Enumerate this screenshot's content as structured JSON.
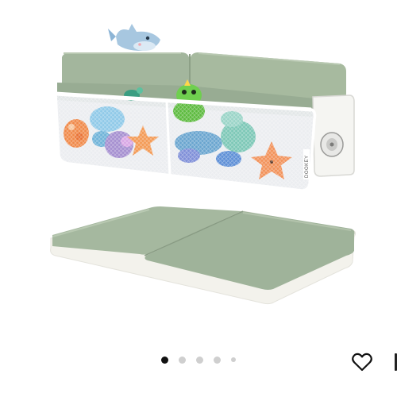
{
  "product": {
    "brand_label": "DOOKEY"
  },
  "carousel": {
    "total": 5,
    "active_index": 0
  },
  "actions": {
    "favorite_icon": "heart-outline-icon"
  },
  "colors": {
    "mat_green": "#a4b79e",
    "mat_edge": "#f4f3ee",
    "dot_active": "#111111",
    "dot_inactive": "#cfcfcf"
  }
}
